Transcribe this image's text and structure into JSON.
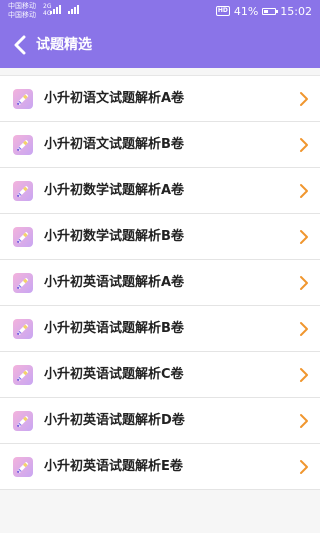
{
  "status_bar": {
    "carrier_1": "中国移动",
    "carrier_2": "中国移动",
    "net_1": "2G",
    "net_2": "4G",
    "hd": "HD",
    "battery": "41%",
    "time": "15:02",
    "battery_level": 0.41
  },
  "header": {
    "title": "试题精选",
    "back_icon": "chevron-left-icon"
  },
  "colors": {
    "accent": "#8a74e8",
    "chevron": "#f0962e",
    "text": "#222222",
    "background": "#f6f6f6"
  },
  "items": [
    {
      "label": "小升初语文试题解析A卷",
      "icon": "pencil-icon"
    },
    {
      "label": "小升初语文试题解析B卷",
      "icon": "pencil-icon"
    },
    {
      "label": "小升初数学试题解析A卷",
      "icon": "pencil-icon"
    },
    {
      "label": "小升初数学试题解析B卷",
      "icon": "pencil-icon"
    },
    {
      "label": "小升初英语试题解析A卷",
      "icon": "pencil-icon"
    },
    {
      "label": "小升初英语试题解析B卷",
      "icon": "pencil-icon"
    },
    {
      "label": "小升初英语试题解析C卷",
      "icon": "pencil-icon"
    },
    {
      "label": "小升初英语试题解析D卷",
      "icon": "pencil-icon"
    },
    {
      "label": "小升初英语试题解析E卷",
      "icon": "pencil-icon"
    }
  ]
}
